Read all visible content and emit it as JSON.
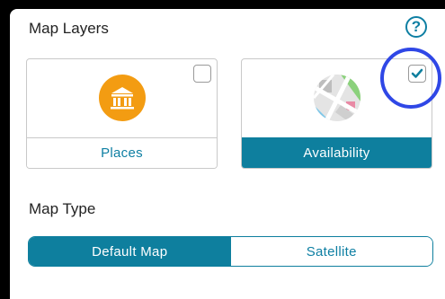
{
  "map_layers": {
    "title": "Map Layers",
    "help_label": "?",
    "cards": [
      {
        "label": "Places",
        "checked": false,
        "icon": "museum-icon"
      },
      {
        "label": "Availability",
        "checked": true,
        "icon": "map-icon"
      }
    ]
  },
  "map_type": {
    "title": "Map Type",
    "options": [
      {
        "label": "Default Map",
        "selected": true
      },
      {
        "label": "Satellite",
        "selected": false
      }
    ]
  },
  "colors": {
    "accent": "#0e7f9e",
    "highlight_ring": "#2f47e6",
    "places_icon_bg": "#f39c12"
  }
}
